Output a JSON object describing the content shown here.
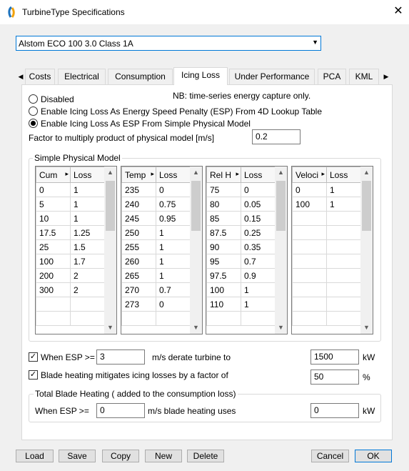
{
  "window": {
    "title": "TurbineType Specifications",
    "close_glyph": "✕"
  },
  "combo": {
    "value": "Alstom ECO 100 3.0 Class 1A",
    "arrow": "▼"
  },
  "tabs": [
    {
      "label": "Costs"
    },
    {
      "label": "Electrical"
    },
    {
      "label": "Consumption"
    },
    {
      "label": "Icing Loss"
    },
    {
      "label": "Under Performance"
    },
    {
      "label": "PCA"
    },
    {
      "label": "KML"
    }
  ],
  "tab_arrows": {
    "left": "◀",
    "right": "▶"
  },
  "icing": {
    "nb": "NB: time-series energy capture only.",
    "options": [
      "Disabled",
      "Enable Icing Loss As Energy Speed Penalty (ESP) From 4D Lookup Table",
      "Enable Icing Loss As ESP From Simple Physical Model"
    ],
    "selected_option": 2,
    "factor_label": "Factor to multiply product of physical model [m/s]",
    "factor_value": "0.2",
    "model_title": "Simple Physical Model",
    "grids": [
      {
        "headers": [
          "Cum",
          "Loss"
        ],
        "rows": [
          [
            "0",
            "1"
          ],
          [
            "5",
            "1"
          ],
          [
            "10",
            "1"
          ],
          [
            "17.5",
            "1.25"
          ],
          [
            "25",
            "1.5"
          ],
          [
            "100",
            "1.7"
          ],
          [
            "200",
            "2"
          ],
          [
            "300",
            "2"
          ],
          [
            "",
            ""
          ],
          [
            "",
            ""
          ]
        ]
      },
      {
        "headers": [
          "Temp",
          "Loss"
        ],
        "rows": [
          [
            "235",
            "0"
          ],
          [
            "240",
            "0.75"
          ],
          [
            "245",
            "0.95"
          ],
          [
            "250",
            "1"
          ],
          [
            "255",
            "1"
          ],
          [
            "260",
            "1"
          ],
          [
            "265",
            "1"
          ],
          [
            "270",
            "0.7"
          ],
          [
            "273",
            "0"
          ],
          [
            "",
            ""
          ]
        ]
      },
      {
        "headers": [
          "Rel H",
          "Loss"
        ],
        "rows": [
          [
            "75",
            "0"
          ],
          [
            "80",
            "0.05"
          ],
          [
            "85",
            "0.15"
          ],
          [
            "87.5",
            "0.25"
          ],
          [
            "90",
            "0.35"
          ],
          [
            "95",
            "0.7"
          ],
          [
            "97.5",
            "0.9"
          ],
          [
            "100",
            "1"
          ],
          [
            "110",
            "1"
          ],
          [
            "",
            ""
          ]
        ]
      },
      {
        "headers": [
          "Veloci",
          "Loss"
        ],
        "rows": [
          [
            "0",
            "1"
          ],
          [
            "100",
            "1"
          ],
          [
            "",
            ""
          ],
          [
            "",
            ""
          ],
          [
            "",
            ""
          ],
          [
            "",
            ""
          ],
          [
            "",
            ""
          ],
          [
            "",
            ""
          ],
          [
            "",
            ""
          ],
          [
            "",
            ""
          ]
        ]
      }
    ],
    "header_arrow": "▸",
    "scroll_up": "▲",
    "scroll_down": "▼",
    "esp_check_label": "When ESP >=",
    "esp_check_checked": true,
    "esp_value": "3",
    "esp_derate_label": "m/s derate turbine to",
    "esp_derate_value": "1500",
    "esp_derate_unit": "kW",
    "blade_check_label": "Blade heating mitigates icing losses by a factor of",
    "blade_check_checked": true,
    "blade_factor_value": "50",
    "blade_factor_unit": "%",
    "heating_title": "Total Blade Heating ( added to the consumption loss)",
    "heating_when_label": "When ESP >=",
    "heating_esp_value": "0",
    "heating_uses_label": "m/s blade heating uses",
    "heating_kw_value": "0",
    "heating_kw_unit": "kW",
    "check_glyph": "✓"
  },
  "buttons": {
    "load": "Load",
    "save": "Save",
    "copy": "Copy",
    "new": "New",
    "delete": "Delete",
    "cancel": "Cancel",
    "ok": "OK"
  }
}
